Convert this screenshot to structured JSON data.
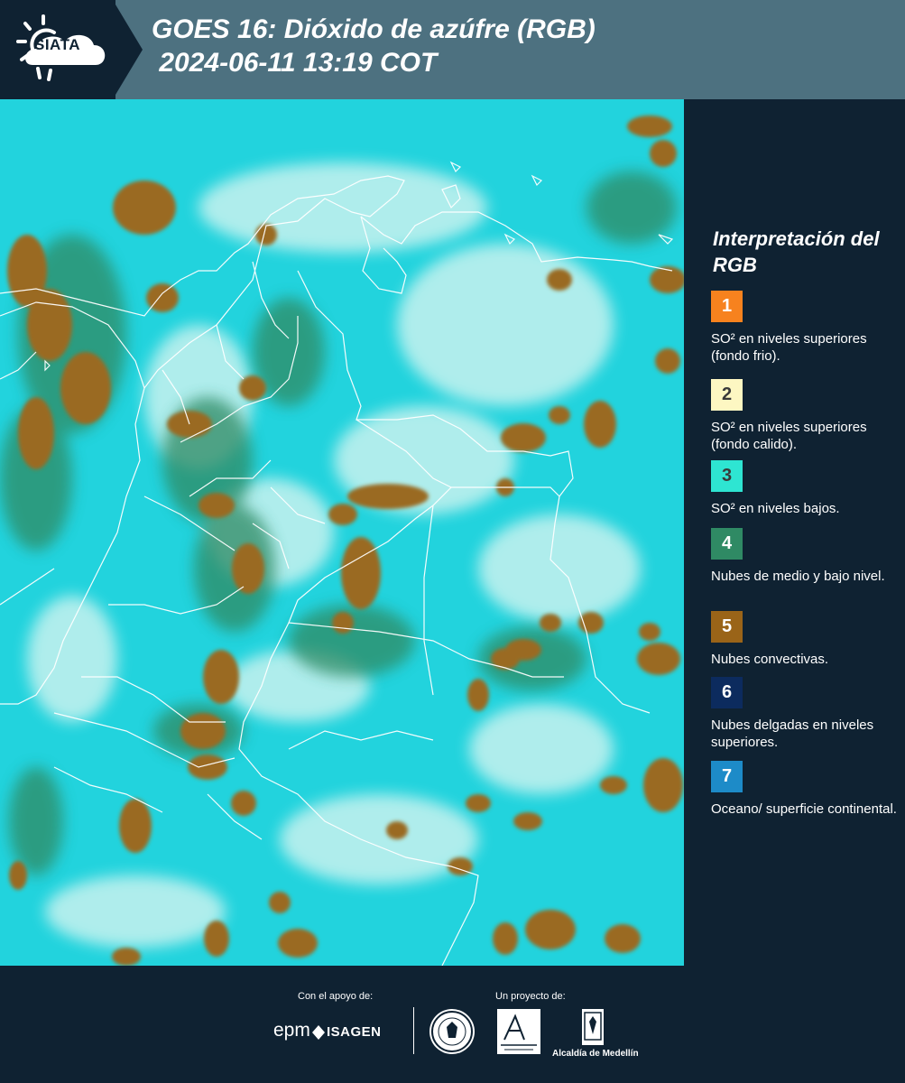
{
  "header": {
    "logo_text": "SIATA",
    "title_line1": "GOES 16: Dióxido de azúfre (RGB)",
    "title_line2": " 2024-06-11 13:19 COT"
  },
  "legend": {
    "title": "Interpretación del RGB",
    "items": [
      {
        "number": "1",
        "color": "#f7821e",
        "text_color": "#ffffff",
        "label": "SO² en niveles superiores (fondo frio)."
      },
      {
        "number": "2",
        "color": "#fdf7c2",
        "text_color": "#3a3a3a",
        "label": "SO² en niveles superiores (fondo calido)."
      },
      {
        "number": "3",
        "color": "#2ee5d2",
        "text_color": "#3a3a3a",
        "label": "SO² en niveles bajos."
      },
      {
        "number": "4",
        "color": "#2f8a64",
        "text_color": "#ffffff",
        "label": "Nubes de medio y bajo nivel."
      },
      {
        "number": "5",
        "color": "#9a6418",
        "text_color": "#ffffff",
        "label": "Nubes convectivas."
      },
      {
        "number": "6",
        "color": "#0c2b5e",
        "text_color": "#ffffff",
        "label": "Nubes delgadas en niveles superiores."
      },
      {
        "number": "7",
        "color": "#1d8bc8",
        "text_color": "#ffffff",
        "label": "Oceano/ superficie continental."
      }
    ]
  },
  "footer": {
    "support_label": "Con el apoyo de:",
    "project_label": "Un proyecto de:",
    "epm": "epm",
    "isagen": "ISAGEN",
    "alcaldia": "Alcaldía de Medellín"
  },
  "colors": {
    "background_dark": "#0f2232",
    "header_band": "#4d7180",
    "map_cyan": "#22d3dd",
    "cloud_light": "#c4f1ee",
    "convective_brown": "#9a6a24",
    "midlevel_green": "#2f8a64"
  }
}
